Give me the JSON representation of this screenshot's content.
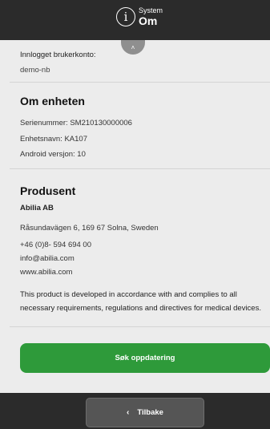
{
  "header": {
    "subtitle": "System",
    "title": "Om",
    "icon": "info-icon",
    "icon_glyph": "i"
  },
  "scroll_handle": {
    "icon": "chevron-up-icon",
    "glyph": "˄"
  },
  "account": {
    "label": "Innlogget brukerkonto:",
    "value": "demo-nb"
  },
  "device": {
    "title": "Om enheten",
    "serial_label": "Serienummer:",
    "serial_value": "SM210130000006",
    "name_label": "Enhetsnavn:",
    "name_value": "KA107",
    "android_label": "Android versjon:",
    "android_value": "10"
  },
  "producer": {
    "title": "Produsent",
    "company": "Abilia AB",
    "address": "Råsundavägen 6, 169 67 Solna, Sweden",
    "phone": "+46 (0)8- 594 694 00",
    "email": "info@abilia.com",
    "website": "www.abilia.com",
    "compliance": "This product is developed in accordance with and complies to all necessary requirements, regulations and directives for medical devices."
  },
  "actions": {
    "update_label": "Søk oppdatering",
    "back_label": "Tilbake",
    "back_icon": "chevron-left-icon",
    "back_glyph": "‹"
  },
  "colors": {
    "header_bg": "#2b2b2b",
    "page_bg": "#ececec",
    "accent_green": "#2e9a3a"
  }
}
